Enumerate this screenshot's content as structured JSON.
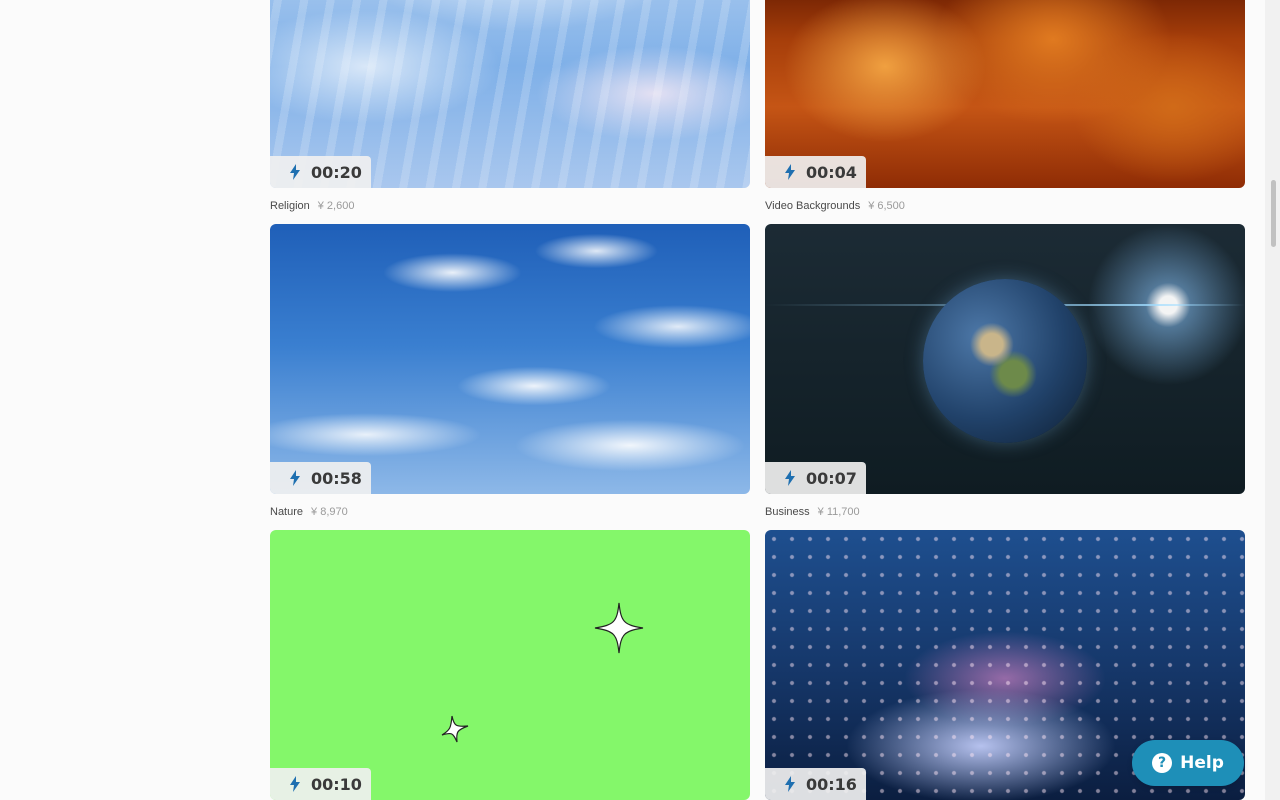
{
  "cards": [
    {
      "duration": "00:20",
      "category": "Religion",
      "price": "¥ 2,600"
    },
    {
      "duration": "00:04",
      "category": "Video Backgrounds",
      "price": "¥ 6,500"
    },
    {
      "duration": "00:58",
      "category": "Nature",
      "price": "¥ 8,970"
    },
    {
      "duration": "00:07",
      "category": "Business",
      "price": "¥ 11,700"
    },
    {
      "duration": "00:10",
      "category": "",
      "price": ""
    },
    {
      "duration": "00:16",
      "category": "",
      "price": ""
    }
  ],
  "icons": {
    "duration": "lightning-bolt-icon",
    "help": "question-circle-icon"
  },
  "help": {
    "label": "Help",
    "icon_glyph": "?"
  },
  "colors": {
    "help_button": "#1e8fb8",
    "duration_text": "#3a3a3a",
    "duration_icon": "#1e6fb0",
    "green_screen": "#84f76a"
  }
}
